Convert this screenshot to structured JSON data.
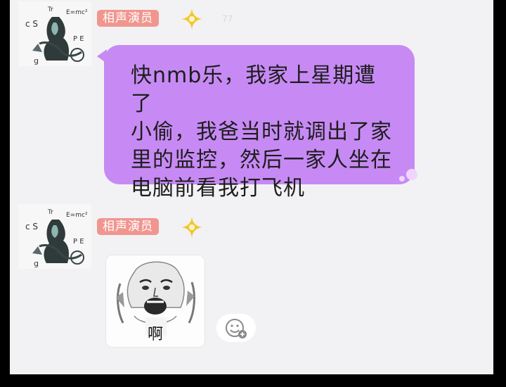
{
  "messages": [
    {
      "sender_badge": "相声演员",
      "faint_mark": "77",
      "text": "快nmb乐，我家上星期遭了\n小偷，我爸当时就调出了家\n里的监控，然后一家人坐在\n电脑前看我打飞机"
    },
    {
      "sender_badge": "相声演员",
      "sticker_caption": "啊"
    }
  ],
  "avatar_marks": {
    "top_left": "Tr",
    "formula": "E=mc²",
    "letters": "c S",
    "side": "P E",
    "bottom": "g"
  },
  "colors": {
    "bubble": "#c78af4",
    "badge": "#f0968f",
    "background": "#f2f2f4",
    "star": "#f3c62e"
  },
  "icons": [
    "star-icon",
    "emoji-icon"
  ]
}
